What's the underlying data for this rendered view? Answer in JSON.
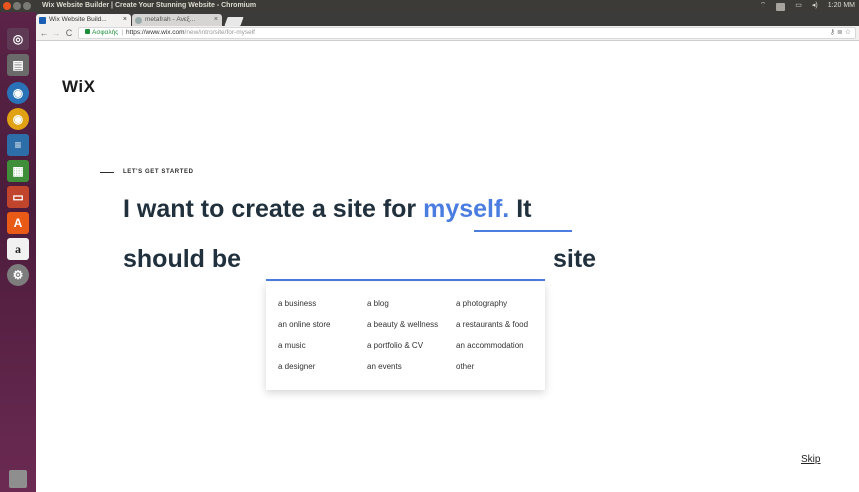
{
  "top_panel": {
    "title": "Wix Website Builder | Create Your Stunning Website - Chromium",
    "tray": [
      "1:20 MM"
    ]
  },
  "launcher": {
    "items": [
      "ubuntu-dash",
      "files",
      "chromium",
      "chrome",
      "libreoffice-writer",
      "libreoffice-calc",
      "libreoffice-impress",
      "software-center",
      "a",
      "settings",
      "trash"
    ]
  },
  "browser": {
    "tabs": [
      {
        "label": "Wix Website Build...",
        "active": true
      },
      {
        "label": "metafrah - Ανεξ...",
        "active": false
      }
    ],
    "address": {
      "secure_label": "Ασφαλής",
      "host": "https://www.wix.com",
      "path": "/new/intro/site/for-myself"
    }
  },
  "page": {
    "logo": "WiX",
    "eyebrow": "LET'S GET STARTED",
    "headline_prefix": "I want to create a site for",
    "headline_highlight": "myself.",
    "headline_suffix": "It",
    "line2_prefix": "should be",
    "line2_suffix": "site",
    "options": [
      [
        "a business",
        "a blog",
        "a photography"
      ],
      [
        "an online store",
        "a beauty & wellness",
        "a restaurants & food"
      ],
      [
        "a music",
        "a portfolio & CV",
        "an accommodation"
      ],
      [
        "a designer",
        "an events",
        "other"
      ]
    ],
    "skip": "Skip"
  },
  "colors": {
    "accent": "#4b7de0",
    "heading": "#20303c",
    "launcher": "#5a2347"
  }
}
